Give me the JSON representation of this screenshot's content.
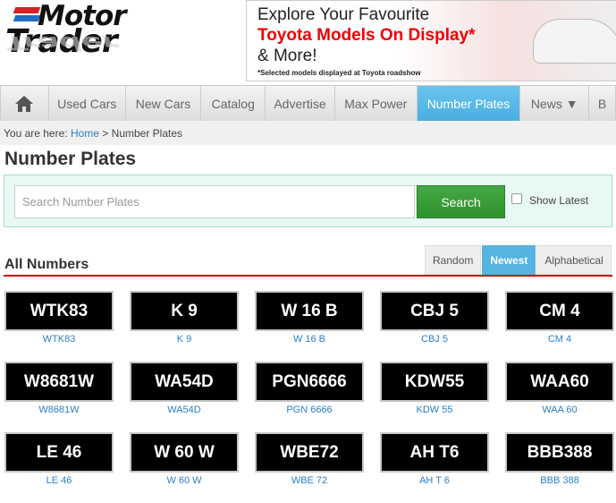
{
  "logo": {
    "line1": "Motor",
    "line2": "Trader",
    "colors": {
      "red": "#d61f26",
      "blue": "#1e6fc4"
    }
  },
  "banner": {
    "line1": "Explore Your Favourite",
    "line2": "Toyota Models On Display*",
    "line3": "& More!",
    "footnote": "*Selected models displayed at Toyota roadshow"
  },
  "nav": {
    "home_icon": "home-icon",
    "items": [
      {
        "label": "Used Cars",
        "w": 86
      },
      {
        "label": "New Cars",
        "w": 85
      },
      {
        "label": "Catalog",
        "w": 72
      },
      {
        "label": "Advertise",
        "w": 78
      },
      {
        "label": "Max Power",
        "w": 92
      },
      {
        "label": "Number Plates",
        "w": 116,
        "active": true
      },
      {
        "label": "News ▼",
        "w": 77
      },
      {
        "label": "B",
        "w": 30
      }
    ]
  },
  "breadcrumb": {
    "prefix": "You are here: ",
    "home": "Home",
    "separator": " > ",
    "current": "Number Plates"
  },
  "page_title": "Number Plates",
  "search": {
    "placeholder": "Search Number Plates",
    "value": "",
    "button": "Search",
    "checkbox_label": "Show Latest",
    "checked": false
  },
  "section_title": "All Numbers",
  "sort_tabs": [
    {
      "label": "Random"
    },
    {
      "label": "Newest",
      "active": true
    },
    {
      "label": "Alphabetical"
    }
  ],
  "accent": "#56b3e2",
  "plates": [
    {
      "plate": "WTK83",
      "label": "WTK83"
    },
    {
      "plate": "K 9",
      "label": "K 9"
    },
    {
      "plate": "W 16 B",
      "label": "W 16 B"
    },
    {
      "plate": "CBJ 5",
      "label": "CBJ 5"
    },
    {
      "plate": "CM 4",
      "label": "CM 4"
    },
    {
      "plate": "W8681W",
      "label": "W8681W"
    },
    {
      "plate": "WA54D",
      "label": "WA54D"
    },
    {
      "plate": "PGN6666",
      "label": "PGN 6666"
    },
    {
      "plate": "KDW55",
      "label": "KDW 55"
    },
    {
      "plate": "WAA60",
      "label": "WAA 60"
    },
    {
      "plate": "LE 46",
      "label": "LE 46"
    },
    {
      "plate": "W 60 W",
      "label": "W 60 W"
    },
    {
      "plate": "WBE72",
      "label": "WBE 72"
    },
    {
      "plate": "AH T6",
      "label": "AH T 6"
    },
    {
      "plate": "BBB388",
      "label": "BBB 388"
    }
  ]
}
